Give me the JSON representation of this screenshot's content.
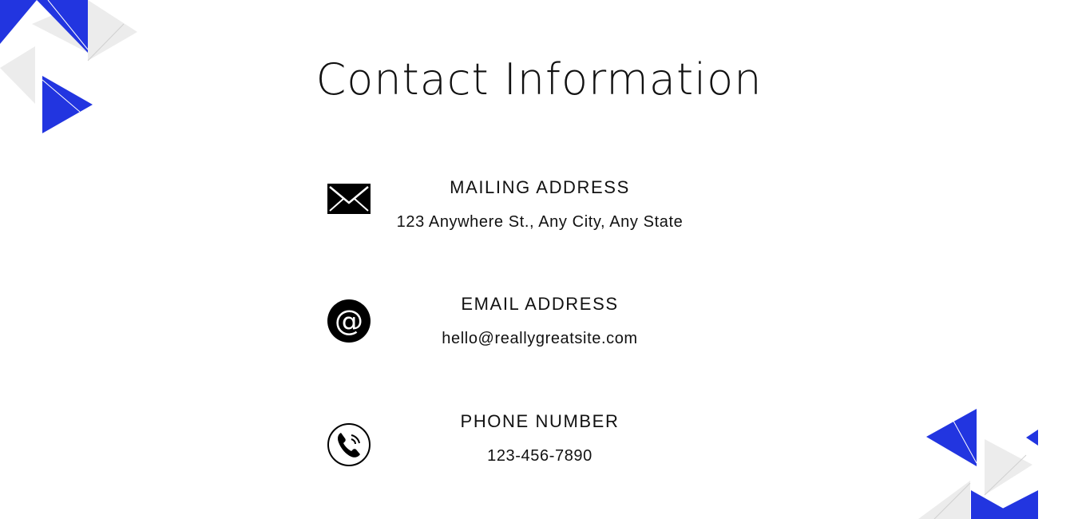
{
  "title": "Contact Information",
  "colors": {
    "accent": "#2235e0",
    "decor_gray": "#ececec",
    "text": "#111111",
    "background": "#ffffff"
  },
  "contacts": [
    {
      "icon": "envelope-icon",
      "label": "MAILING ADDRESS",
      "value": "123 Anywhere St., Any City, Any State"
    },
    {
      "icon": "at-sign-icon",
      "label": "EMAIL ADDRESS",
      "value": "hello@reallygreatsite.com"
    },
    {
      "icon": "phone-icon",
      "label": "PHONE NUMBER",
      "value": "123-456-7890"
    }
  ]
}
